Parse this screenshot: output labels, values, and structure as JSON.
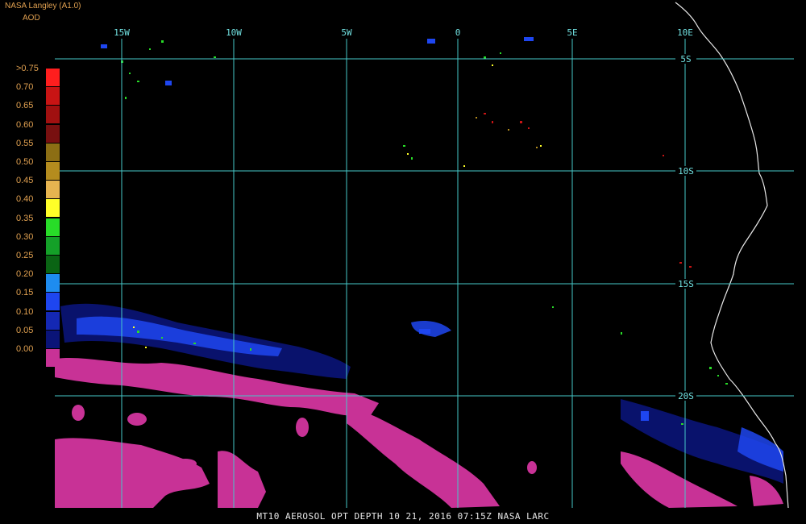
{
  "header": {
    "source": "NASA Langley (A1.0)",
    "product": "AOD"
  },
  "legend": {
    "items": [
      {
        "label": ">0.75",
        "color": "#ff1e1e"
      },
      {
        "label": "0.70",
        "color": "#c81414"
      },
      {
        "label": "0.65",
        "color": "#a01010"
      },
      {
        "label": "0.60",
        "color": "#781010"
      },
      {
        "label": "0.55",
        "color": "#8c6e14"
      },
      {
        "label": "0.50",
        "color": "#b48c1e"
      },
      {
        "label": "0.45",
        "color": "#e6b450"
      },
      {
        "label": "0.40",
        "color": "#ffff28"
      },
      {
        "label": "0.35",
        "color": "#28dc28"
      },
      {
        "label": "0.30",
        "color": "#14a028"
      },
      {
        "label": "0.25",
        "color": "#0a6414"
      },
      {
        "label": "0.20",
        "color": "#1e8cf0"
      },
      {
        "label": "0.15",
        "color": "#1e46f0"
      },
      {
        "label": "0.10",
        "color": "#1428b4"
      },
      {
        "label": "0.05",
        "color": "#0a1478"
      },
      {
        "label": "0.00",
        "color": "#c83296"
      }
    ]
  },
  "grid": {
    "color": "#46c8c8",
    "longitudes": [
      "15W",
      "10W",
      "5W",
      "0",
      "5E",
      "10E"
    ],
    "latitudes": [
      "5S",
      "10S",
      "15S",
      "20S"
    ]
  },
  "footer": {
    "text": "MT10  AEROSOL OPT DEPTH   10 21, 2016 07:15Z   NASA LARC"
  }
}
